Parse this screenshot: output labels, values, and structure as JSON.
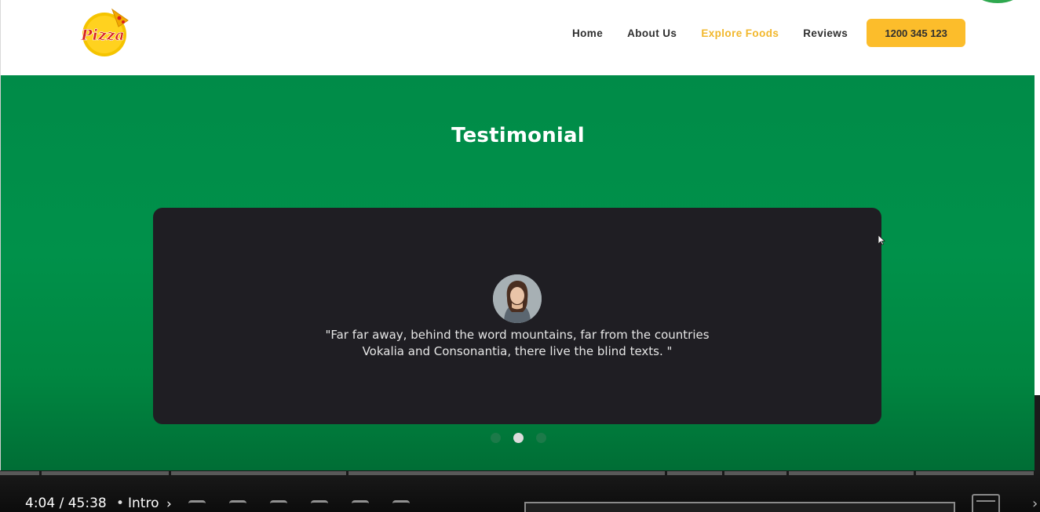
{
  "header": {
    "logo_text": "Pizza",
    "nav": {
      "items": [
        {
          "label": "Home"
        },
        {
          "label": "About Us"
        },
        {
          "label": "Explore Foods"
        },
        {
          "label": "Reviews"
        }
      ],
      "active_item": "Explore Foods"
    },
    "phone_button": "1200 345 123"
  },
  "testimonial": {
    "title": "Testimonial",
    "quote_line1": "\"Far far away, behind the word mountains, far from the countries",
    "quote_line2": "Vokalia and Consonantia, there live the blind texts. \"",
    "carousel_dots": 3,
    "active_dot": 2
  },
  "video_player": {
    "time": "4:04 / 45:38",
    "separator": "•",
    "chapter": "Intro",
    "chapter_chevron": "›"
  },
  "colors": {
    "section_green": "#00914a",
    "card_dark": "#1f1e23",
    "accent_yellow": "#fcbd2b",
    "nav_active": "#f2b72b",
    "nav_text": "#2f2f2f"
  },
  "icons": [
    "pizza-logo",
    "avatar-photo",
    "mouse-cursor",
    "share-icon",
    "grid-icon",
    "chevron-right-icon"
  ]
}
